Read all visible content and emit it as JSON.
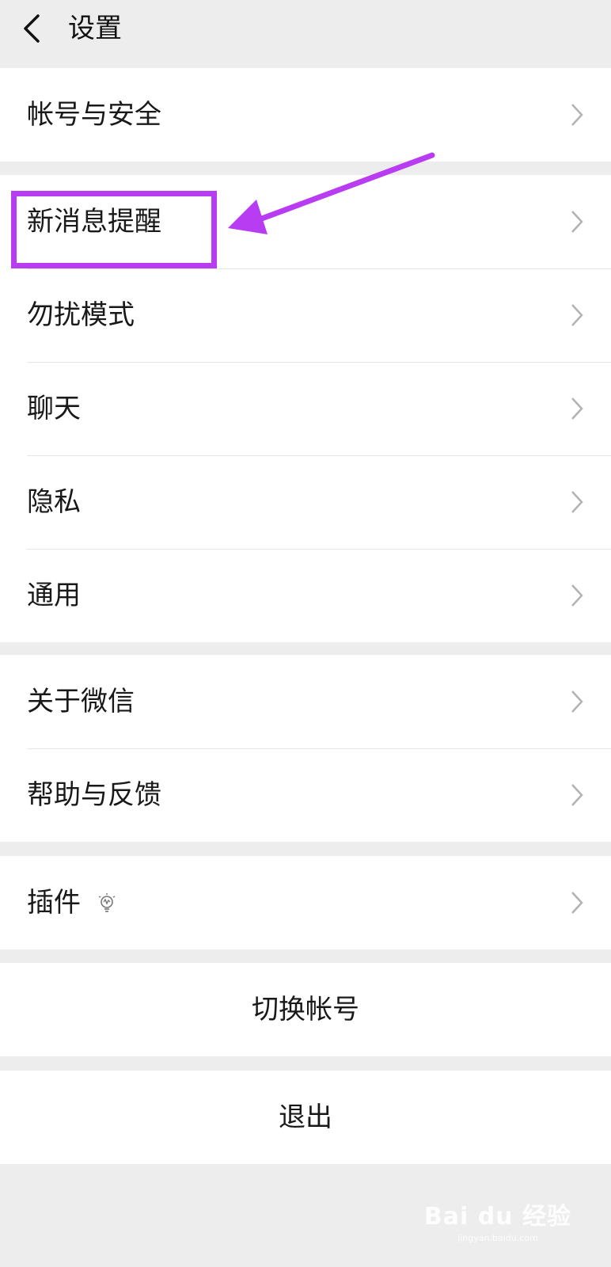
{
  "header": {
    "title": "设置"
  },
  "groups": [
    {
      "items": [
        {
          "label": "帐号与安全"
        }
      ]
    },
    {
      "items": [
        {
          "label": "新消息提醒"
        },
        {
          "label": "勿扰模式"
        },
        {
          "label": "聊天"
        },
        {
          "label": "隐私"
        },
        {
          "label": "通用"
        }
      ]
    },
    {
      "items": [
        {
          "label": "关于微信"
        },
        {
          "label": "帮助与反馈"
        }
      ]
    },
    {
      "items": [
        {
          "label": "插件",
          "icon": "lightbulb-icon"
        }
      ]
    }
  ],
  "actions": {
    "switch_account": "切换帐号",
    "logout": "退出"
  },
  "annotation": {
    "color": "#b73cf2",
    "highlighted_item": "新消息提醒"
  },
  "watermark": {
    "main": "Bai du 经验",
    "sub": "jingyan.baidu.com"
  }
}
